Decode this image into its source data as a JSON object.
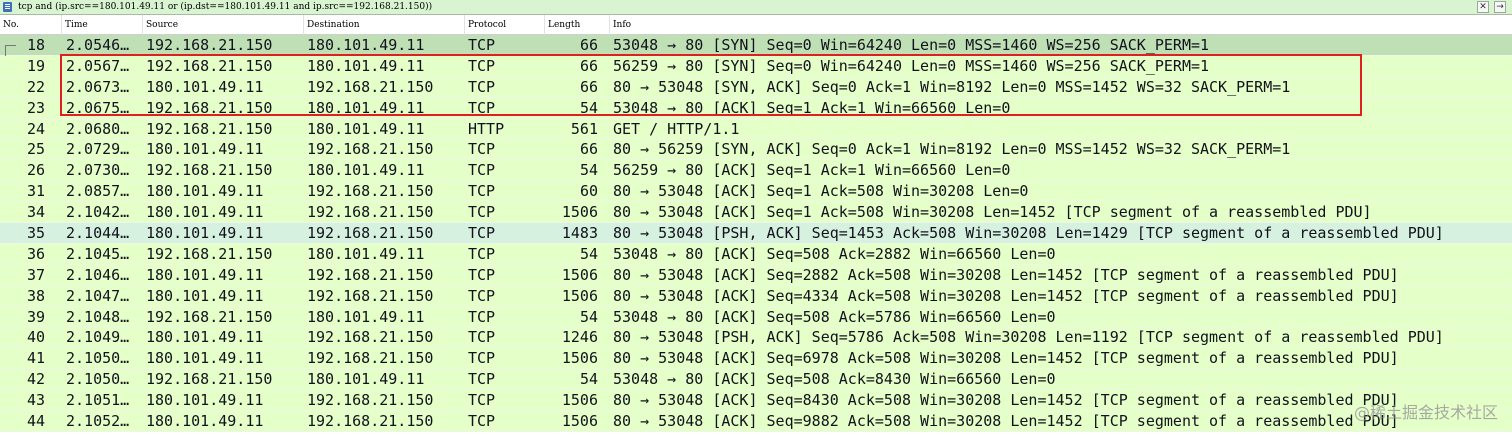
{
  "filter": {
    "expression": "tcp and (ip.src==180.101.49.11 or (ip.dst==180.101.49.11 and ip.src==192.168.21.150))",
    "clear_glyph": "✕",
    "apply_glyph": "→"
  },
  "columns": {
    "no": "No.",
    "time": "Time",
    "source": "Source",
    "destination": "Destination",
    "protocol": "Protocol",
    "length": "Length",
    "info": "Info"
  },
  "packets": [
    {
      "no": "18",
      "time": "2.0546…",
      "source": "192.168.21.150",
      "destination": "180.101.49.11",
      "protocol": "TCP",
      "length": "66",
      "info": "53048 → 80 [SYN] Seq=0 Win=64240 Len=0 MSS=1460 WS=256 SACK_PERM=1"
    },
    {
      "no": "19",
      "time": "2.0567…",
      "source": "192.168.21.150",
      "destination": "180.101.49.11",
      "protocol": "TCP",
      "length": "66",
      "info": "56259 → 80 [SYN] Seq=0 Win=64240 Len=0 MSS=1460 WS=256 SACK_PERM=1"
    },
    {
      "no": "22",
      "time": "2.0673…",
      "source": "180.101.49.11",
      "destination": "192.168.21.150",
      "protocol": "TCP",
      "length": "66",
      "info": "80 → 53048 [SYN, ACK] Seq=0 Ack=1 Win=8192 Len=0 MSS=1452 WS=32 SACK_PERM=1"
    },
    {
      "no": "23",
      "time": "2.0675…",
      "source": "192.168.21.150",
      "destination": "180.101.49.11",
      "protocol": "TCP",
      "length": "54",
      "info": "53048 → 80 [ACK] Seq=1 Ack=1 Win=66560 Len=0"
    },
    {
      "no": "24",
      "time": "2.0680…",
      "source": "192.168.21.150",
      "destination": "180.101.49.11",
      "protocol": "HTTP",
      "length": "561",
      "info": "GET / HTTP/1.1"
    },
    {
      "no": "25",
      "time": "2.0729…",
      "source": "180.101.49.11",
      "destination": "192.168.21.150",
      "protocol": "TCP",
      "length": "66",
      "info": "80 → 56259 [SYN, ACK] Seq=0 Ack=1 Win=8192 Len=0 MSS=1452 WS=32 SACK_PERM=1"
    },
    {
      "no": "26",
      "time": "2.0730…",
      "source": "192.168.21.150",
      "destination": "180.101.49.11",
      "protocol": "TCP",
      "length": "54",
      "info": "56259 → 80 [ACK] Seq=1 Ack=1 Win=66560 Len=0"
    },
    {
      "no": "31",
      "time": "2.0857…",
      "source": "180.101.49.11",
      "destination": "192.168.21.150",
      "protocol": "TCP",
      "length": "60",
      "info": "80 → 53048 [ACK] Seq=1 Ack=508 Win=30208 Len=0"
    },
    {
      "no": "34",
      "time": "2.1042…",
      "source": "180.101.49.11",
      "destination": "192.168.21.150",
      "protocol": "TCP",
      "length": "1506",
      "info": "80 → 53048 [ACK] Seq=1 Ack=508 Win=30208 Len=1452 [TCP segment of a reassembled PDU]"
    },
    {
      "no": "35",
      "time": "2.1044…",
      "source": "180.101.49.11",
      "destination": "192.168.21.150",
      "protocol": "TCP",
      "length": "1483",
      "info": "80 → 53048 [PSH, ACK] Seq=1453 Ack=508 Win=30208 Len=1429 [TCP segment of a reassembled PDU]"
    },
    {
      "no": "36",
      "time": "2.1045…",
      "source": "192.168.21.150",
      "destination": "180.101.49.11",
      "protocol": "TCP",
      "length": "54",
      "info": "53048 → 80 [ACK] Seq=508 Ack=2882 Win=66560 Len=0"
    },
    {
      "no": "37",
      "time": "2.1046…",
      "source": "180.101.49.11",
      "destination": "192.168.21.150",
      "protocol": "TCP",
      "length": "1506",
      "info": "80 → 53048 [ACK] Seq=2882 Ack=508 Win=30208 Len=1452 [TCP segment of a reassembled PDU]"
    },
    {
      "no": "38",
      "time": "2.1047…",
      "source": "180.101.49.11",
      "destination": "192.168.21.150",
      "protocol": "TCP",
      "length": "1506",
      "info": "80 → 53048 [ACK] Seq=4334 Ack=508 Win=30208 Len=1452 [TCP segment of a reassembled PDU]"
    },
    {
      "no": "39",
      "time": "2.1048…",
      "source": "192.168.21.150",
      "destination": "180.101.49.11",
      "protocol": "TCP",
      "length": "54",
      "info": "53048 → 80 [ACK] Seq=508 Ack=5786 Win=66560 Len=0"
    },
    {
      "no": "40",
      "time": "2.1049…",
      "source": "180.101.49.11",
      "destination": "192.168.21.150",
      "protocol": "TCP",
      "length": "1246",
      "info": "80 → 53048 [PSH, ACK] Seq=5786 Ack=508 Win=30208 Len=1192 [TCP segment of a reassembled PDU]"
    },
    {
      "no": "41",
      "time": "2.1050…",
      "source": "180.101.49.11",
      "destination": "192.168.21.150",
      "protocol": "TCP",
      "length": "1506",
      "info": "80 → 53048 [ACK] Seq=6978 Ack=508 Win=30208 Len=1452 [TCP segment of a reassembled PDU]"
    },
    {
      "no": "42",
      "time": "2.1050…",
      "source": "192.168.21.150",
      "destination": "180.101.49.11",
      "protocol": "TCP",
      "length": "54",
      "info": "53048 → 80 [ACK] Seq=508 Ack=8430 Win=66560 Len=0"
    },
    {
      "no": "43",
      "time": "2.1051…",
      "source": "180.101.49.11",
      "destination": "192.168.21.150",
      "protocol": "TCP",
      "length": "1506",
      "info": "80 → 53048 [ACK] Seq=8430 Ack=508 Win=30208 Len=1452 [TCP segment of a reassembled PDU]"
    },
    {
      "no": "44",
      "time": "2.1052…",
      "source": "180.101.49.11",
      "destination": "192.168.21.150",
      "protocol": "TCP",
      "length": "1506",
      "info": "80 → 53048 [ACK] Seq=9882 Ack=508 Win=30208 Len=1452 [TCP segment of a reassembled PDU]"
    }
  ],
  "selected_packet": "18",
  "highlighted_packets": [
    "19",
    "22",
    "23"
  ],
  "watermark": "@稀土掘金技术社区",
  "colors": {
    "row_tcp": "#e4ffc7",
    "row_selected": "#bfe0b4",
    "row_psh": "#d7f1e0",
    "annotation_box": "#e02020",
    "filter_bar": "#d8f4d0"
  }
}
